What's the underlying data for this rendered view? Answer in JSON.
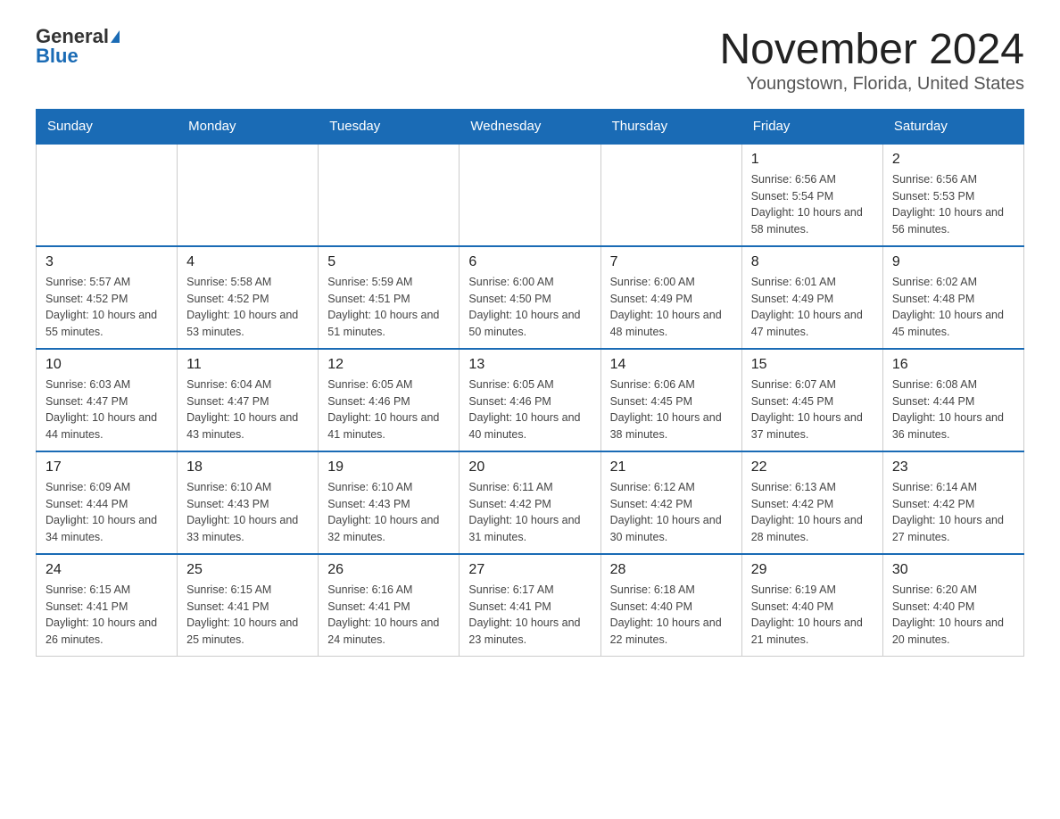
{
  "header": {
    "logo_general": "General",
    "logo_blue": "Blue",
    "month_title": "November 2024",
    "location": "Youngstown, Florida, United States"
  },
  "days_of_week": [
    "Sunday",
    "Monday",
    "Tuesday",
    "Wednesday",
    "Thursday",
    "Friday",
    "Saturday"
  ],
  "weeks": [
    [
      {
        "day": "",
        "sunrise": "",
        "sunset": "",
        "daylight": ""
      },
      {
        "day": "",
        "sunrise": "",
        "sunset": "",
        "daylight": ""
      },
      {
        "day": "",
        "sunrise": "",
        "sunset": "",
        "daylight": ""
      },
      {
        "day": "",
        "sunrise": "",
        "sunset": "",
        "daylight": ""
      },
      {
        "day": "",
        "sunrise": "",
        "sunset": "",
        "daylight": ""
      },
      {
        "day": "1",
        "sunrise": "Sunrise: 6:56 AM",
        "sunset": "Sunset: 5:54 PM",
        "daylight": "Daylight: 10 hours and 58 minutes."
      },
      {
        "day": "2",
        "sunrise": "Sunrise: 6:56 AM",
        "sunset": "Sunset: 5:53 PM",
        "daylight": "Daylight: 10 hours and 56 minutes."
      }
    ],
    [
      {
        "day": "3",
        "sunrise": "Sunrise: 5:57 AM",
        "sunset": "Sunset: 4:52 PM",
        "daylight": "Daylight: 10 hours and 55 minutes."
      },
      {
        "day": "4",
        "sunrise": "Sunrise: 5:58 AM",
        "sunset": "Sunset: 4:52 PM",
        "daylight": "Daylight: 10 hours and 53 minutes."
      },
      {
        "day": "5",
        "sunrise": "Sunrise: 5:59 AM",
        "sunset": "Sunset: 4:51 PM",
        "daylight": "Daylight: 10 hours and 51 minutes."
      },
      {
        "day": "6",
        "sunrise": "Sunrise: 6:00 AM",
        "sunset": "Sunset: 4:50 PM",
        "daylight": "Daylight: 10 hours and 50 minutes."
      },
      {
        "day": "7",
        "sunrise": "Sunrise: 6:00 AM",
        "sunset": "Sunset: 4:49 PM",
        "daylight": "Daylight: 10 hours and 48 minutes."
      },
      {
        "day": "8",
        "sunrise": "Sunrise: 6:01 AM",
        "sunset": "Sunset: 4:49 PM",
        "daylight": "Daylight: 10 hours and 47 minutes."
      },
      {
        "day": "9",
        "sunrise": "Sunrise: 6:02 AM",
        "sunset": "Sunset: 4:48 PM",
        "daylight": "Daylight: 10 hours and 45 minutes."
      }
    ],
    [
      {
        "day": "10",
        "sunrise": "Sunrise: 6:03 AM",
        "sunset": "Sunset: 4:47 PM",
        "daylight": "Daylight: 10 hours and 44 minutes."
      },
      {
        "day": "11",
        "sunrise": "Sunrise: 6:04 AM",
        "sunset": "Sunset: 4:47 PM",
        "daylight": "Daylight: 10 hours and 43 minutes."
      },
      {
        "day": "12",
        "sunrise": "Sunrise: 6:05 AM",
        "sunset": "Sunset: 4:46 PM",
        "daylight": "Daylight: 10 hours and 41 minutes."
      },
      {
        "day": "13",
        "sunrise": "Sunrise: 6:05 AM",
        "sunset": "Sunset: 4:46 PM",
        "daylight": "Daylight: 10 hours and 40 minutes."
      },
      {
        "day": "14",
        "sunrise": "Sunrise: 6:06 AM",
        "sunset": "Sunset: 4:45 PM",
        "daylight": "Daylight: 10 hours and 38 minutes."
      },
      {
        "day": "15",
        "sunrise": "Sunrise: 6:07 AM",
        "sunset": "Sunset: 4:45 PM",
        "daylight": "Daylight: 10 hours and 37 minutes."
      },
      {
        "day": "16",
        "sunrise": "Sunrise: 6:08 AM",
        "sunset": "Sunset: 4:44 PM",
        "daylight": "Daylight: 10 hours and 36 minutes."
      }
    ],
    [
      {
        "day": "17",
        "sunrise": "Sunrise: 6:09 AM",
        "sunset": "Sunset: 4:44 PM",
        "daylight": "Daylight: 10 hours and 34 minutes."
      },
      {
        "day": "18",
        "sunrise": "Sunrise: 6:10 AM",
        "sunset": "Sunset: 4:43 PM",
        "daylight": "Daylight: 10 hours and 33 minutes."
      },
      {
        "day": "19",
        "sunrise": "Sunrise: 6:10 AM",
        "sunset": "Sunset: 4:43 PM",
        "daylight": "Daylight: 10 hours and 32 minutes."
      },
      {
        "day": "20",
        "sunrise": "Sunrise: 6:11 AM",
        "sunset": "Sunset: 4:42 PM",
        "daylight": "Daylight: 10 hours and 31 minutes."
      },
      {
        "day": "21",
        "sunrise": "Sunrise: 6:12 AM",
        "sunset": "Sunset: 4:42 PM",
        "daylight": "Daylight: 10 hours and 30 minutes."
      },
      {
        "day": "22",
        "sunrise": "Sunrise: 6:13 AM",
        "sunset": "Sunset: 4:42 PM",
        "daylight": "Daylight: 10 hours and 28 minutes."
      },
      {
        "day": "23",
        "sunrise": "Sunrise: 6:14 AM",
        "sunset": "Sunset: 4:42 PM",
        "daylight": "Daylight: 10 hours and 27 minutes."
      }
    ],
    [
      {
        "day": "24",
        "sunrise": "Sunrise: 6:15 AM",
        "sunset": "Sunset: 4:41 PM",
        "daylight": "Daylight: 10 hours and 26 minutes."
      },
      {
        "day": "25",
        "sunrise": "Sunrise: 6:15 AM",
        "sunset": "Sunset: 4:41 PM",
        "daylight": "Daylight: 10 hours and 25 minutes."
      },
      {
        "day": "26",
        "sunrise": "Sunrise: 6:16 AM",
        "sunset": "Sunset: 4:41 PM",
        "daylight": "Daylight: 10 hours and 24 minutes."
      },
      {
        "day": "27",
        "sunrise": "Sunrise: 6:17 AM",
        "sunset": "Sunset: 4:41 PM",
        "daylight": "Daylight: 10 hours and 23 minutes."
      },
      {
        "day": "28",
        "sunrise": "Sunrise: 6:18 AM",
        "sunset": "Sunset: 4:40 PM",
        "daylight": "Daylight: 10 hours and 22 minutes."
      },
      {
        "day": "29",
        "sunrise": "Sunrise: 6:19 AM",
        "sunset": "Sunset: 4:40 PM",
        "daylight": "Daylight: 10 hours and 21 minutes."
      },
      {
        "day": "30",
        "sunrise": "Sunrise: 6:20 AM",
        "sunset": "Sunset: 4:40 PM",
        "daylight": "Daylight: 10 hours and 20 minutes."
      }
    ]
  ]
}
